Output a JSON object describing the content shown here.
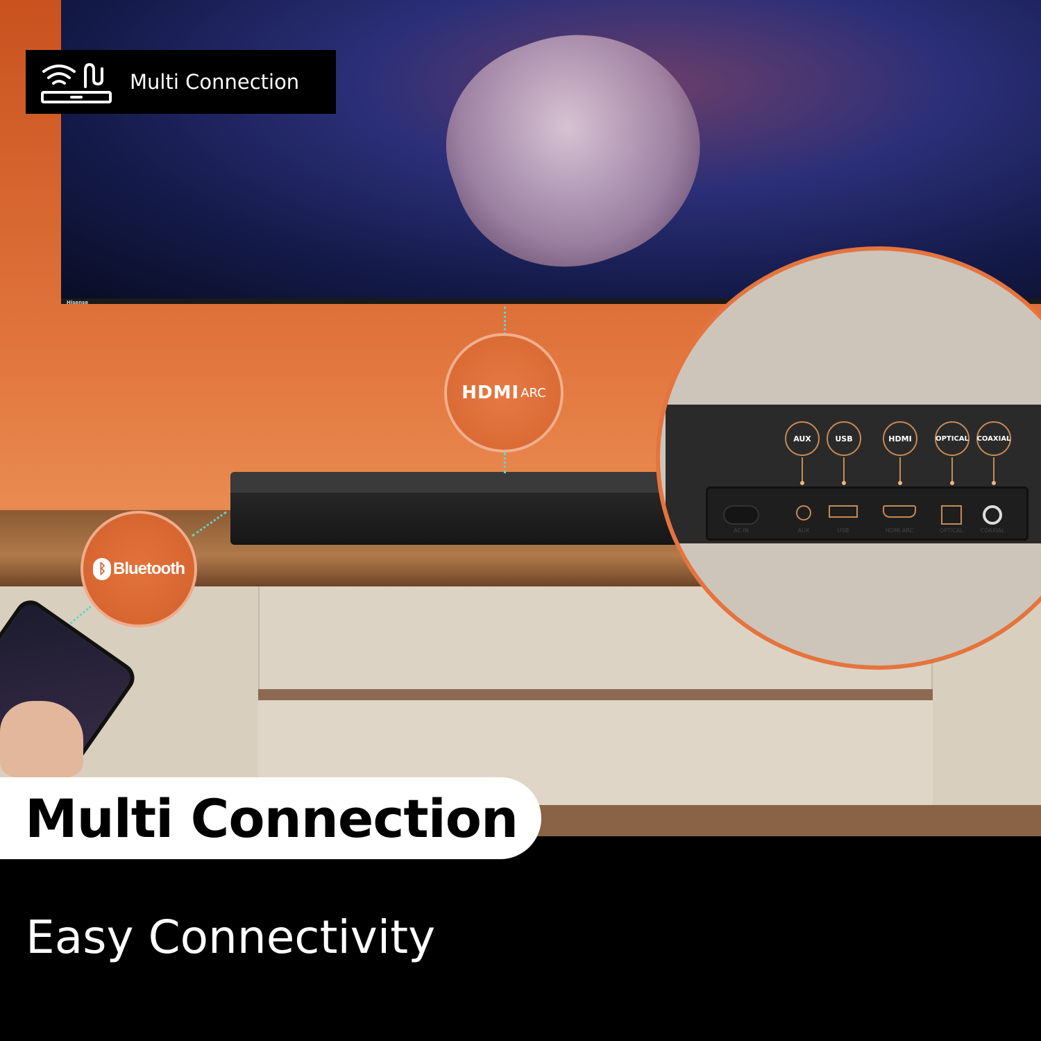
{
  "top_badge": {
    "label": "Multi Connection",
    "icon": "wifi-cable-soundbar-icon"
  },
  "tv": {
    "brand": "Hisense"
  },
  "hdmi_badge": {
    "label": "HDMI",
    "suffix": "ARC"
  },
  "bluetooth_badge": {
    "label": "Bluetooth",
    "icon": "bluetooth-icon"
  },
  "ports": {
    "callouts": [
      "AUX",
      "USB",
      "HDMI",
      "OPTICAL",
      "COAXIAL"
    ],
    "labels": [
      "AC IN",
      "AUX",
      "USB",
      "HDMI ARC",
      "OPTICAL",
      "COAXIAL"
    ]
  },
  "colors": {
    "accent": "#e5743d",
    "connector": "#5fd6c9",
    "port_outline": "#c98a55"
  },
  "headline": "Multi Connection",
  "subheadline": "Easy Connectivity"
}
